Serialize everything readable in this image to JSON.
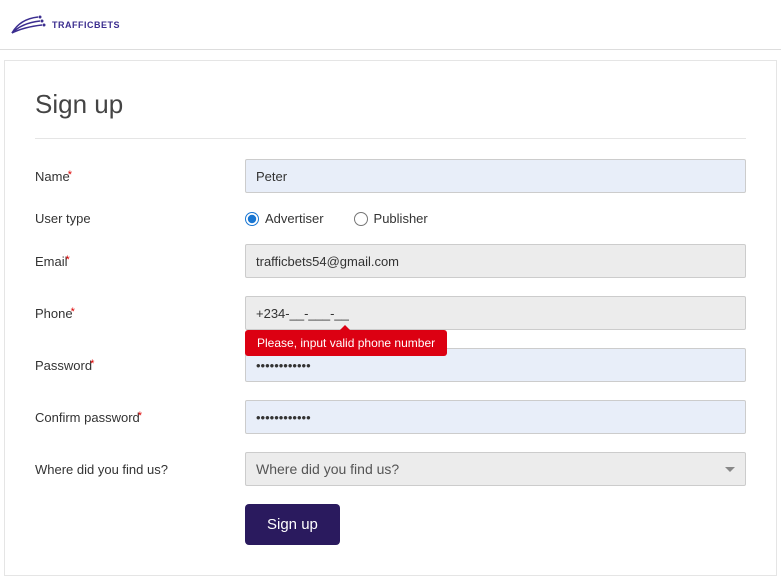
{
  "brand": {
    "name": "TRAFFICBETS"
  },
  "page": {
    "title": "Sign up"
  },
  "form": {
    "name": {
      "label": "Name",
      "value": "Peter",
      "required": true
    },
    "usertype": {
      "label": "User type",
      "options": {
        "advertiser": "Advertiser",
        "publisher": "Publisher"
      },
      "selected": "advertiser"
    },
    "email": {
      "label": "Email",
      "value": "trafficbets54@gmail.com",
      "required": true
    },
    "phone": {
      "label": "Phone",
      "value": "+234-__-___-__",
      "required": true,
      "error": "Please, input valid phone number"
    },
    "password": {
      "label": "Password",
      "value": "••••••••••••",
      "required": true
    },
    "confirm": {
      "label": "Confirm password",
      "value": "••••••••••••",
      "required": true
    },
    "source": {
      "label": "Where did you find us?",
      "placeholder": "Where did you find us?"
    },
    "submit": "Sign up"
  }
}
